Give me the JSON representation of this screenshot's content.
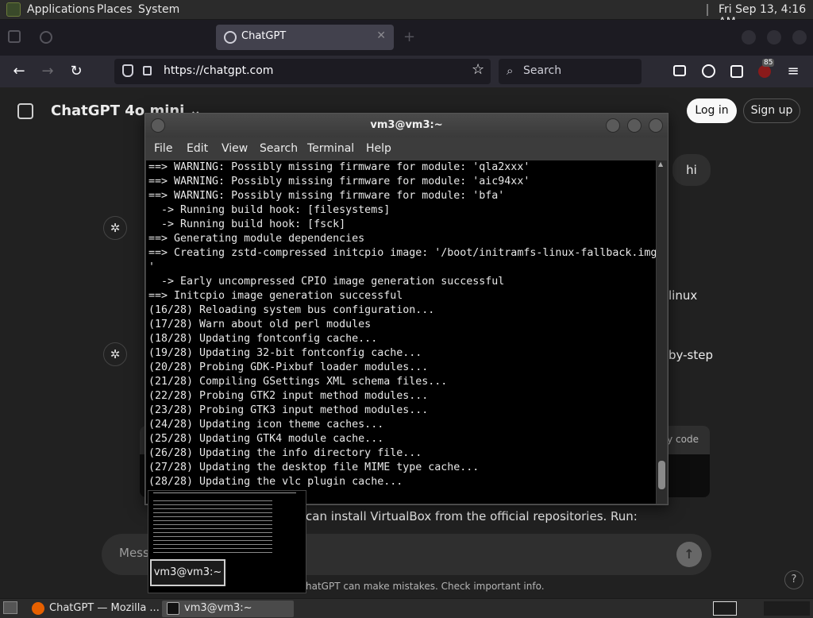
{
  "top_panel": {
    "menus": [
      "Applications",
      "Places",
      "System"
    ],
    "clock": "Fri Sep 13,  4:16 AM"
  },
  "browser": {
    "tabs": [
      {
        "label": "",
        "active": false
      },
      {
        "label": "ChatGPT",
        "active": true
      }
    ],
    "url": "https://chatgpt.com",
    "search_placeholder": "Search",
    "extension_badge": "85"
  },
  "chatgpt": {
    "model_title": "ChatGPT 4o mini ⌄",
    "login_label": "Log in",
    "signup_label": "Sign up",
    "user_message_1": "hi",
    "fragment_linux": "linux",
    "fragment_step": "by-step",
    "copy_code": "Copy code",
    "visible_answer_tail": "can install VirtualBox from the official repositories. Run:",
    "composer_placeholder": "Mess",
    "disclaimer": "hatGPT can make mistakes. Check important info.",
    "help": "?"
  },
  "terminal": {
    "title": "vm3@vm3:~",
    "menus": [
      "File",
      "Edit",
      "View",
      "Search",
      "Terminal",
      "Help"
    ],
    "lines": [
      "==> WARNING: Possibly missing firmware for module: 'qla2xxx'",
      "==> WARNING: Possibly missing firmware for module: 'aic94xx'",
      "==> WARNING: Possibly missing firmware for module: 'bfa'",
      "  -> Running build hook: [filesystems]",
      "  -> Running build hook: [fsck]",
      "==> Generating module dependencies",
      "==> Creating zstd-compressed initcpio image: '/boot/initramfs-linux-fallback.img",
      "'",
      "  -> Early uncompressed CPIO image generation successful",
      "==> Initcpio image generation successful",
      "(16/28) Reloading system bus configuration...",
      "(17/28) Warn about old perl modules",
      "(18/28) Updating fontconfig cache...",
      "(19/28) Updating 32-bit fontconfig cache...",
      "(20/28) Probing GDK-Pixbuf loader modules...",
      "(21/28) Compiling GSettings XML schema files...",
      "(22/28) Probing GTK2 input method modules...",
      "(23/28) Probing GTK3 input method modules...",
      "(24/28) Updating icon theme caches...",
      "(25/28) Updating GTK4 module cache...",
      "(26/28) Updating the info directory file...",
      "(27/28) Updating the desktop file MIME type cache...",
      "(28/28) Updating the vlc plugin cache..."
    ]
  },
  "preview": {
    "label": "vm3@vm3:~"
  },
  "taskbar": {
    "items": [
      {
        "label": "ChatGPT — Mozilla ...",
        "icon": "firefox-icon"
      },
      {
        "label": "vm3@vm3:~",
        "icon": "terminal-icon"
      }
    ]
  }
}
